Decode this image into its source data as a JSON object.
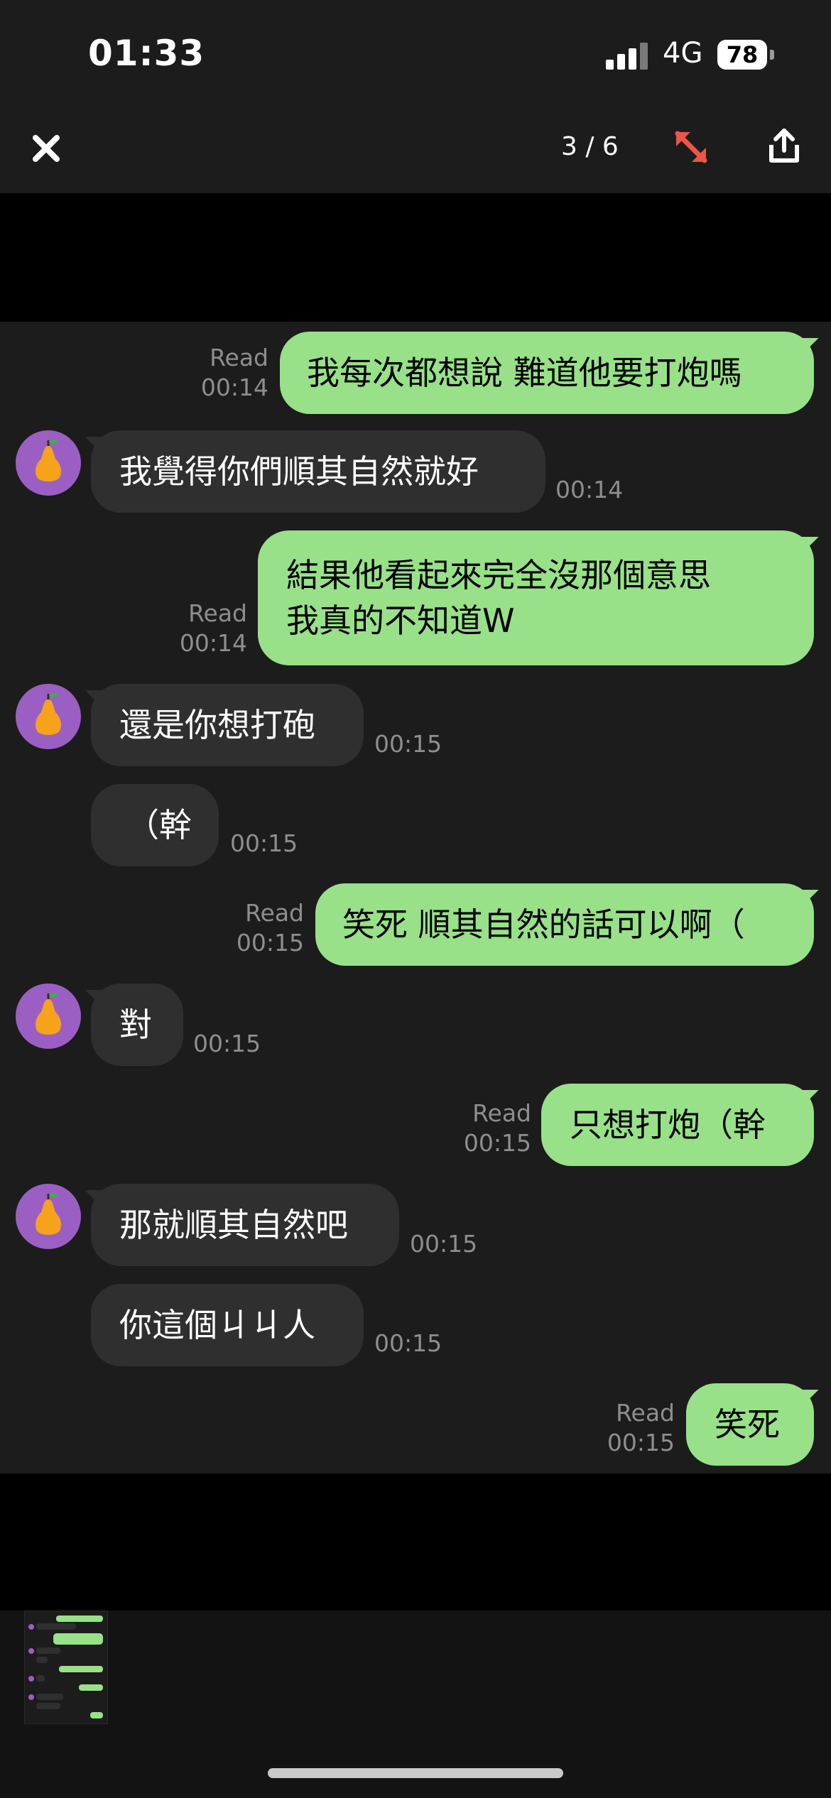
{
  "status_bar": {
    "time": "01:33",
    "network": "4G",
    "battery": "78"
  },
  "toolbar": {
    "counter": "3 / 6"
  },
  "messages": [
    {
      "dir": "out",
      "lines": [
        "我每次都想說 難道他要打炮嗎"
      ],
      "read": "Read",
      "time": "00:14"
    },
    {
      "dir": "in",
      "lines": [
        "我覺得你們順其自然就好"
      ],
      "time": "00:14"
    },
    {
      "dir": "out",
      "lines": [
        "結果他看起來完全沒那個意思",
        "我真的不知道W"
      ],
      "read": "Read",
      "time": "00:14"
    },
    {
      "dir": "in",
      "lines": [
        "還是你想打砲"
      ],
      "time": "00:15"
    },
    {
      "dir": "in",
      "lines": [
        "（幹"
      ],
      "time": "00:15"
    },
    {
      "dir": "out",
      "lines": [
        "笑死 順其自然的話可以啊（"
      ],
      "read": "Read",
      "time": "00:15"
    },
    {
      "dir": "in",
      "lines": [
        "對"
      ],
      "time": "00:15"
    },
    {
      "dir": "out",
      "lines": [
        "只想打炮（幹"
      ],
      "read": "Read",
      "time": "00:15"
    },
    {
      "dir": "in",
      "lines": [
        "那就順其自然吧"
      ],
      "time": "00:15"
    },
    {
      "dir": "in",
      "lines": [
        "你這個ㄐㄐ人"
      ],
      "time": "00:15"
    },
    {
      "dir": "out",
      "lines": [
        "笑死"
      ],
      "read": "Read",
      "time": "00:15"
    }
  ],
  "icons": {
    "close": "close-icon",
    "expand": "expand-arrows-icon",
    "share": "share-icon",
    "avatar": "pear-avatar-icon"
  },
  "colors": {
    "outgoing_bubble": "#98e189",
    "incoming_bubble": "#2f2f2f",
    "chat_background": "#1c1c1c",
    "avatar_background": "#9b5fc3",
    "expand_icon": "#ec5547"
  }
}
